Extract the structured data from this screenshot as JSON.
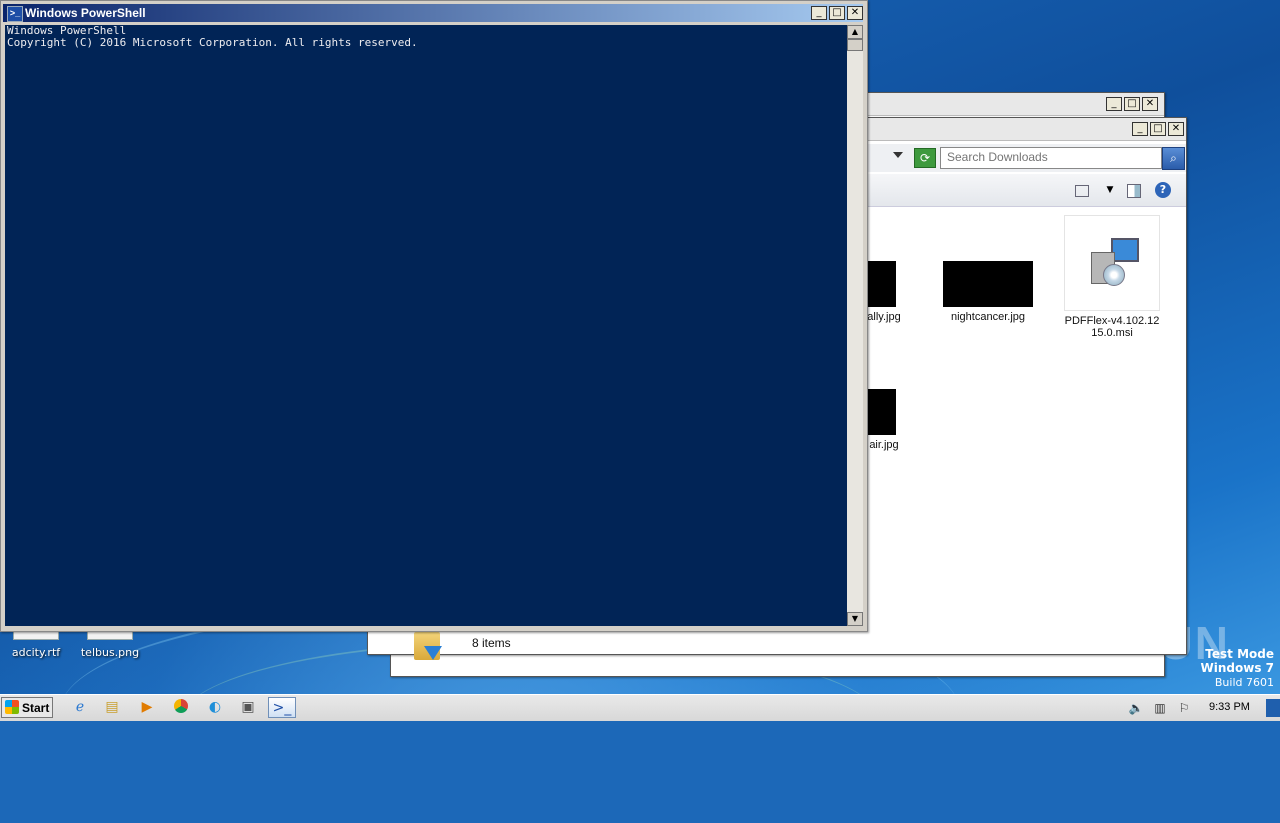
{
  "desktop": {
    "icons": [
      {
        "label": "adcity.rtf"
      },
      {
        "label": "telbus.png"
      }
    ],
    "watermark": "ANY RUN",
    "test_mode": {
      "line1": "Test Mode",
      "line2": "Windows 7",
      "line3": "Build 7601"
    }
  },
  "powershell": {
    "title": "Windows PowerShell",
    "console_lines": [
      "Windows PowerShell",
      "Copyright (C) 2016 Microsoft Corporation. All rights reserved."
    ]
  },
  "explorer": {
    "search_placeholder": "Search Downloads",
    "files": [
      {
        "name": "ally.jpg"
      },
      {
        "name": "nightcancer.jpg"
      },
      {
        "name": "PDFFlex-v4.102.1215.0.msi",
        "line1": "PDFFlex-v4.102.12",
        "line2": "15.0.msi"
      },
      {
        "name": "air.jpg"
      }
    ],
    "item_count": "8 items"
  },
  "taskbar": {
    "start_label": "Start",
    "clock": "9:33 PM"
  },
  "colors": {
    "console_bg": "#012456",
    "title_active": "#0a246a",
    "desktop_blue": "#1d6cc0"
  }
}
